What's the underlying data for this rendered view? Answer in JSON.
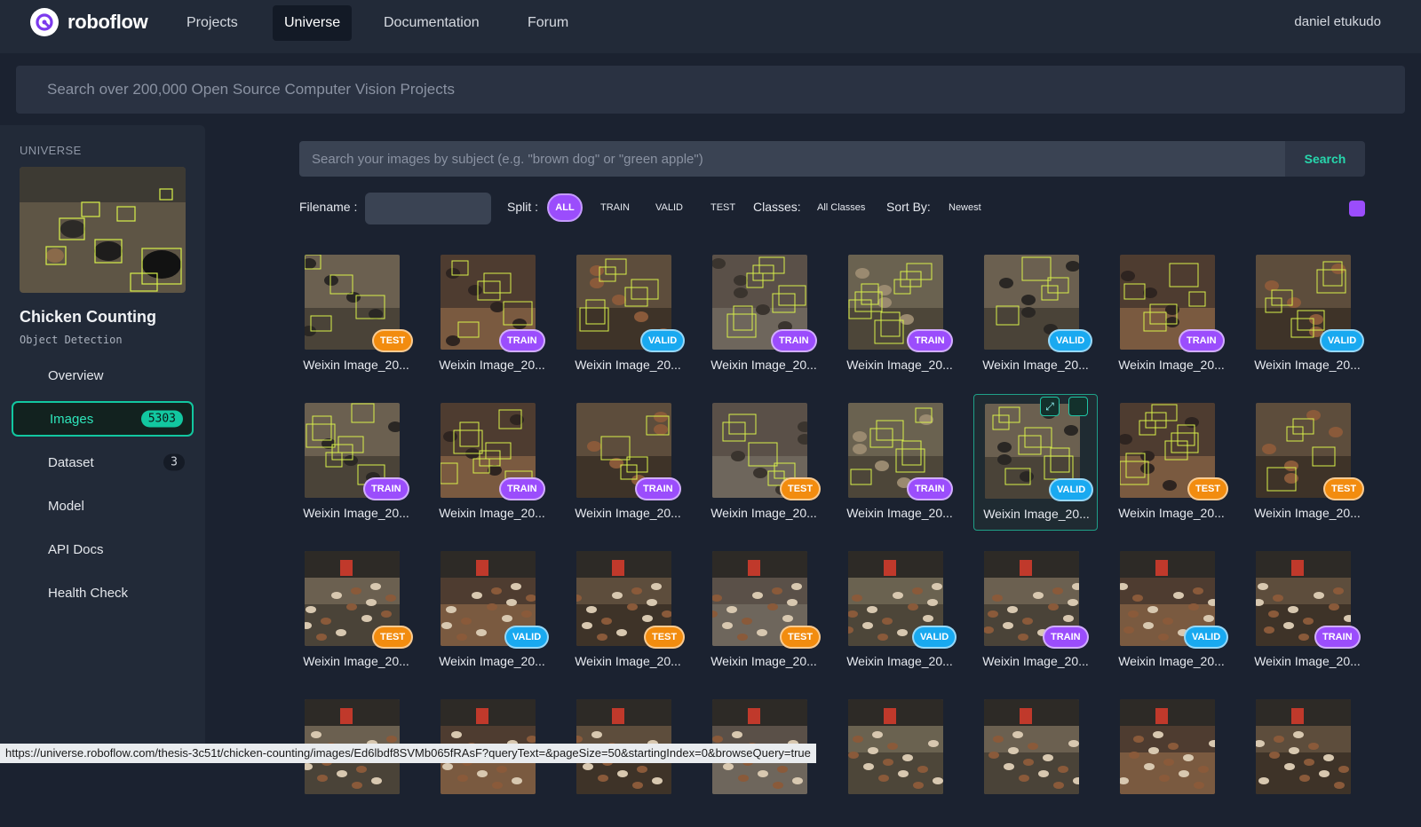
{
  "nav": {
    "brand": "roboflow",
    "items": [
      {
        "label": "Projects",
        "active": false
      },
      {
        "label": "Universe",
        "active": true
      },
      {
        "label": "Documentation",
        "active": false
      },
      {
        "label": "Forum",
        "active": false
      }
    ],
    "user": "daniel etukudo"
  },
  "global_search": {
    "placeholder": "Search over 200,000 Open Source Computer Vision Projects"
  },
  "sidebar": {
    "heading": "UNIVERSE",
    "project_title": "Chicken Counting",
    "project_type": "Object Detection",
    "items": [
      {
        "label": "Overview"
      },
      {
        "label": "Images",
        "badge": "5303",
        "active": true
      },
      {
        "label": "Dataset",
        "badge": "3"
      },
      {
        "label": "Model"
      },
      {
        "label": "API Docs"
      },
      {
        "label": "Health Check"
      }
    ]
  },
  "image_search": {
    "placeholder": "Search your images by subject (e.g. \"brown dog\" or \"green apple\")",
    "button": "Search"
  },
  "filters": {
    "filename_label": "Filename :",
    "split_label": "Split :",
    "split_options": [
      "ALL",
      "TRAIN",
      "VALID",
      "TEST"
    ],
    "classes_label": "Classes:",
    "classes_value": "All Classes",
    "sort_label": "Sort By:",
    "sort_value": "Newest"
  },
  "colors": {
    "train": "#9b4dfc",
    "valid": "#19a9f0",
    "test": "#f28c0f",
    "accent": "#12c7a0"
  },
  "images": [
    {
      "caption": "Weixin Image_20...",
      "split": "TEST"
    },
    {
      "caption": "Weixin Image_20...",
      "split": "TRAIN"
    },
    {
      "caption": "Weixin Image_20...",
      "split": "VALID"
    },
    {
      "caption": "Weixin Image_20...",
      "split": "TRAIN"
    },
    {
      "caption": "Weixin Image_20...",
      "split": "TRAIN"
    },
    {
      "caption": "Weixin Image_20...",
      "split": "VALID"
    },
    {
      "caption": "Weixin Image_20...",
      "split": "TRAIN"
    },
    {
      "caption": "Weixin Image_20...",
      "split": "VALID"
    },
    {
      "caption": "Weixin Image_20...",
      "split": "TRAIN"
    },
    {
      "caption": "Weixin Image_20...",
      "split": "TRAIN"
    },
    {
      "caption": "Weixin Image_20...",
      "split": "TRAIN"
    },
    {
      "caption": "Weixin Image_20...",
      "split": "TEST"
    },
    {
      "caption": "Weixin Image_20...",
      "split": "TRAIN"
    },
    {
      "caption": "Weixin Image_20...",
      "split": "VALID",
      "hover": true
    },
    {
      "caption": "Weixin Image_20...",
      "split": "TEST"
    },
    {
      "caption": "Weixin Image_20...",
      "split": "TEST"
    },
    {
      "caption": "Weixin Image_20...",
      "split": "TEST"
    },
    {
      "caption": "Weixin Image_20...",
      "split": "VALID"
    },
    {
      "caption": "Weixin Image_20...",
      "split": "TEST"
    },
    {
      "caption": "Weixin Image_20...",
      "split": "TEST"
    },
    {
      "caption": "Weixin Image_20...",
      "split": "VALID"
    },
    {
      "caption": "Weixin Image_20...",
      "split": "TRAIN"
    },
    {
      "caption": "Weixin Image_20...",
      "split": "VALID"
    },
    {
      "caption": "Weixin Image_20...",
      "split": "TRAIN"
    },
    {
      "caption": "",
      "split": ""
    },
    {
      "caption": "",
      "split": ""
    },
    {
      "caption": "",
      "split": ""
    },
    {
      "caption": "",
      "split": ""
    },
    {
      "caption": "",
      "split": ""
    },
    {
      "caption": "",
      "split": ""
    },
    {
      "caption": "",
      "split": ""
    },
    {
      "caption": "",
      "split": ""
    }
  ],
  "status_url": "https://universe.roboflow.com/thesis-3c51t/chicken-counting/images/Ed6lbdf8SVMb065fRAsF?queryText=&pageSize=50&startingIndex=0&browseQuery=true"
}
